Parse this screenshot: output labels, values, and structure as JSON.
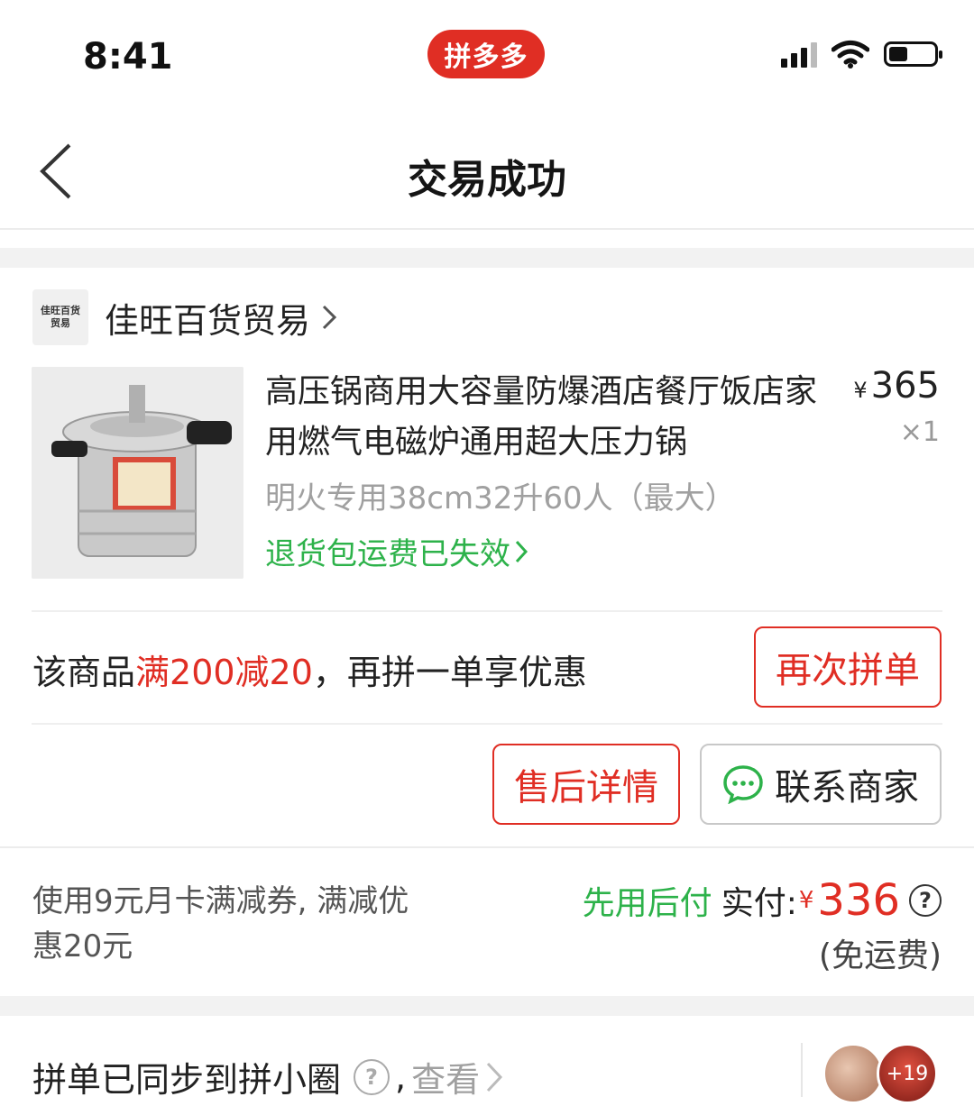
{
  "status_bar": {
    "time": "8:41",
    "app_badge": "拼多多"
  },
  "nav": {
    "title": "交易成功"
  },
  "shop": {
    "logo_text": "佳旺百货\n贸易",
    "name": "佳旺百货贸易"
  },
  "product": {
    "title": "高压锅商用大容量防爆酒店餐厅饭店家用燃气电磁炉通用超大压力锅",
    "currency": "¥",
    "price": "365",
    "quantity": "×1",
    "spec": "明火专用38cm32升60人（最大）",
    "return_notice": "退货包运费已失效"
  },
  "promo": {
    "prefix": "该商品",
    "highlight": "满200减20",
    "suffix": "，再拼一单享优惠",
    "rebuy_button": "再次拼单"
  },
  "actions": {
    "after_sale_button": "售后详情",
    "contact_button": "联系商家"
  },
  "payment": {
    "coupon_note": "使用9元月卡满减券, 满减优惠20元",
    "pay_later": "先用后付",
    "paid_label": "实付:",
    "currency": "¥",
    "amount": "336",
    "help_mark": "?",
    "shipping": "(免运费)"
  },
  "circle": {
    "text": "拼单已同步到拼小圈",
    "help_mark": "?",
    "separator": ",",
    "view_link": "查看",
    "avatar_badge": "+19"
  },
  "colors": {
    "brand_red": "#e02e24",
    "green": "#2db24a"
  }
}
